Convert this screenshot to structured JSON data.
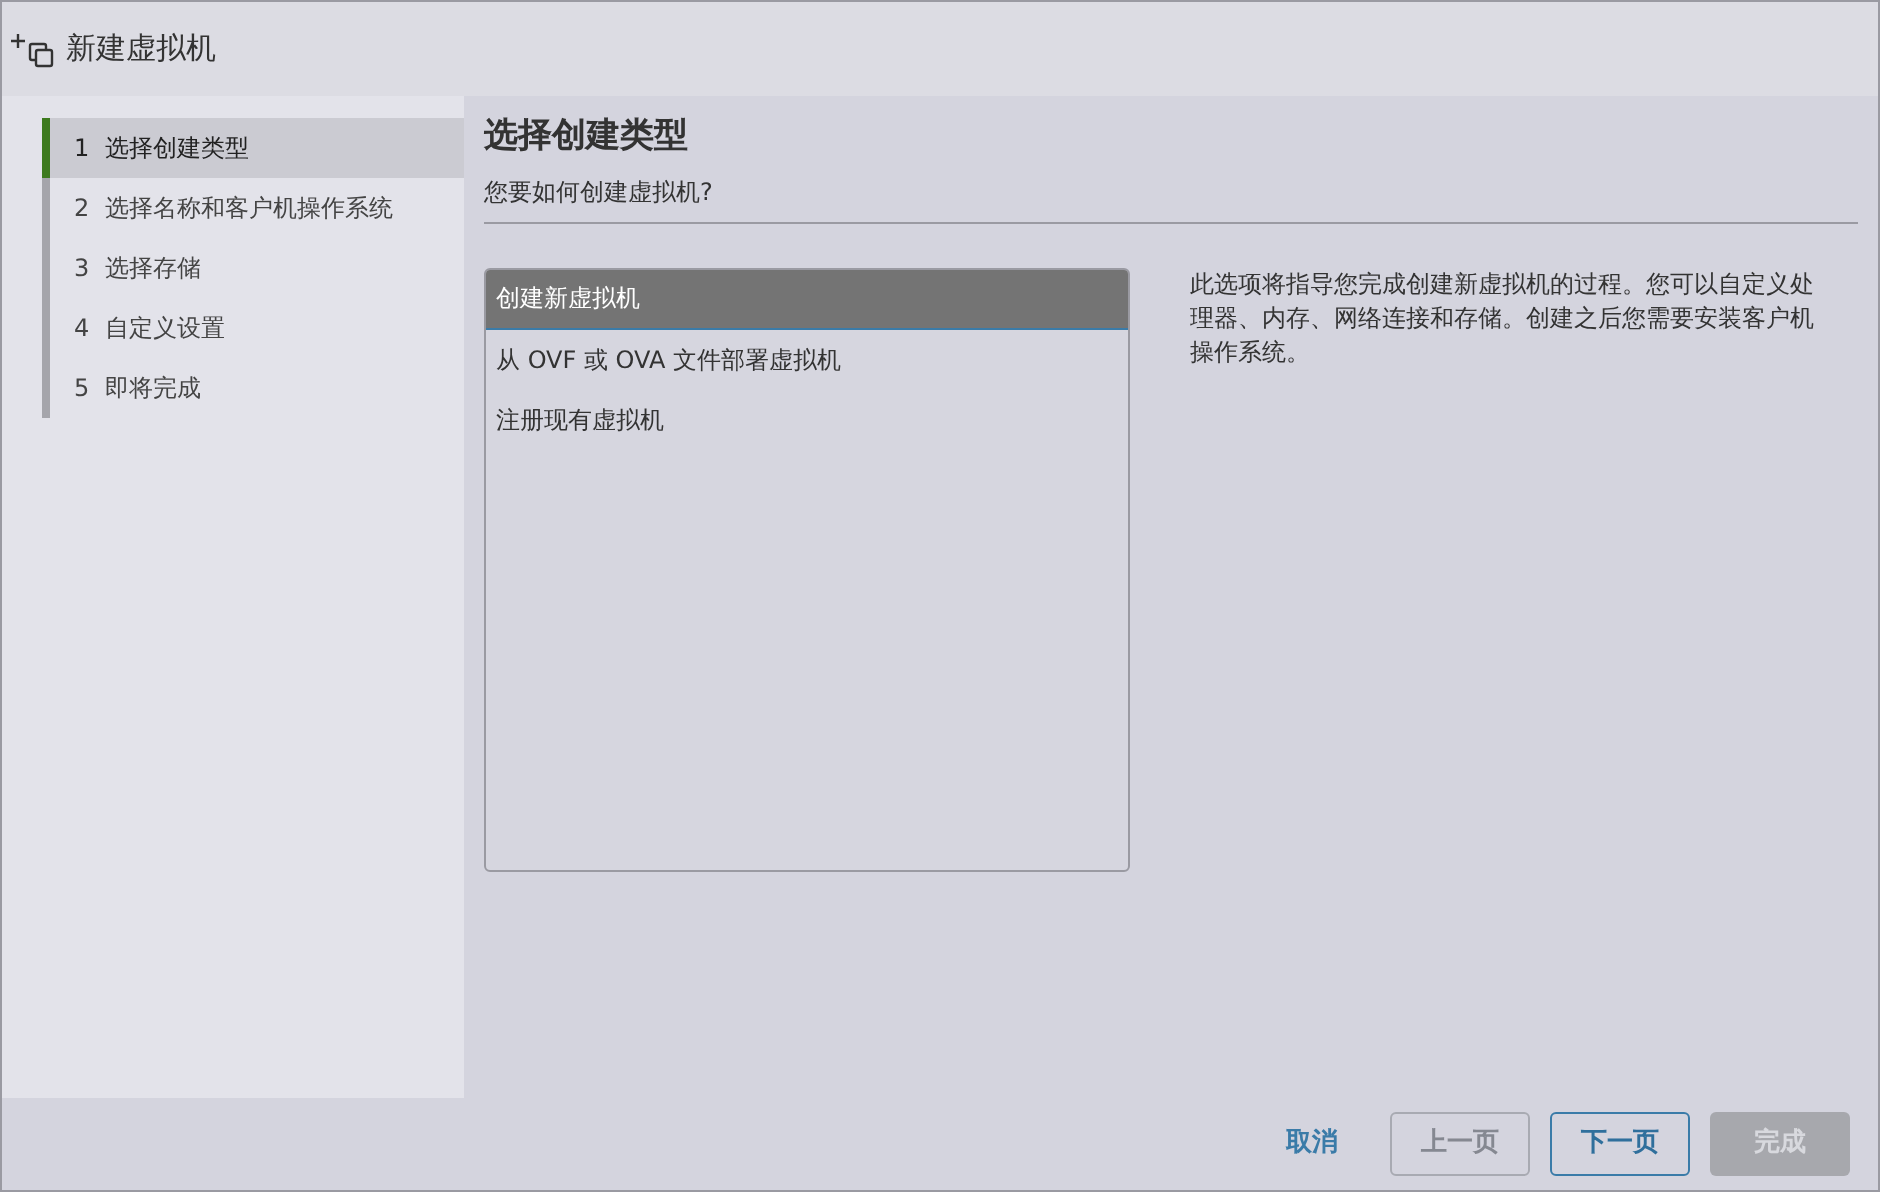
{
  "window": {
    "title": "新建虚拟机"
  },
  "steps": [
    {
      "number": "1",
      "label": "选择创建类型",
      "selected": true
    },
    {
      "number": "2",
      "label": "选择名称和客户机操作系统",
      "selected": false
    },
    {
      "number": "3",
      "label": "选择存储",
      "selected": false
    },
    {
      "number": "4",
      "label": "自定义设置",
      "selected": false
    },
    {
      "number": "5",
      "label": "即将完成",
      "selected": false
    }
  ],
  "page": {
    "heading": "选择创建类型",
    "subheading": "您要如何创建虚拟机?"
  },
  "options": [
    {
      "label": "创建新虚拟机",
      "selected": true
    },
    {
      "label": "从 OVF 或 OVA 文件部署虚拟机",
      "selected": false
    },
    {
      "label": "注册现有虚拟机",
      "selected": false
    }
  ],
  "description": "此选项将指导您完成创建新虚拟机的过程。您可以自定义处理器、内存、网络连接和存储。创建之后您需要安装客户机操作系统。",
  "buttons": [
    {
      "label": "取消",
      "kind": "link",
      "disabled": false
    },
    {
      "label": "上一页",
      "kind": "outline",
      "disabled": true
    },
    {
      "label": "下一页",
      "kind": "outline",
      "disabled": false
    },
    {
      "label": "完成",
      "kind": "solid",
      "disabled": true
    }
  ]
}
